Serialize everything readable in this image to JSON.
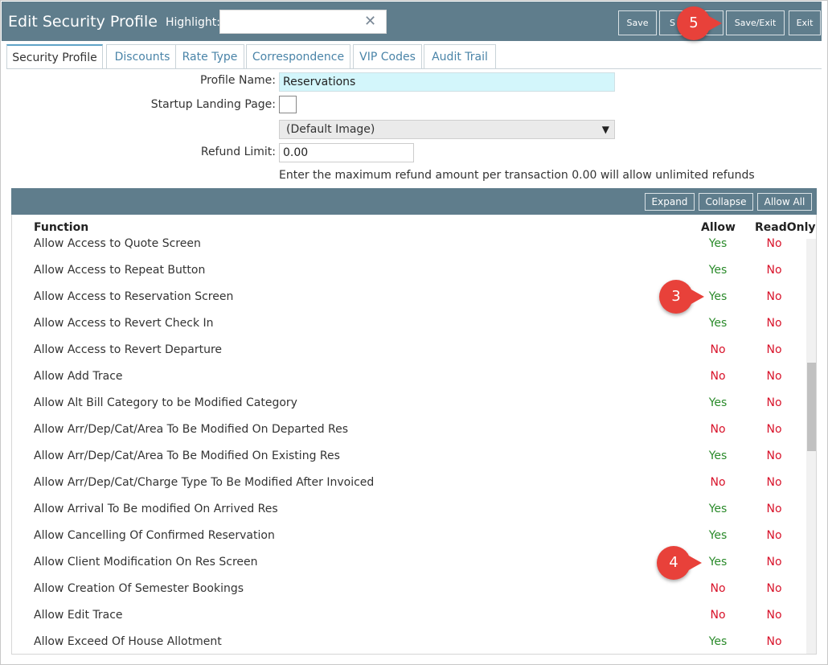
{
  "header": {
    "title": "Edit Security Profile",
    "highlight_label": "Highlight:",
    "highlight_value": "",
    "buttons": [
      {
        "label": "Save"
      },
      {
        "label": "S"
      },
      {
        "label": "Save/Exit"
      },
      {
        "label": "Exit"
      }
    ]
  },
  "annotations": [
    "5",
    "3",
    "4"
  ],
  "tabs": [
    "Security Profile",
    "Discounts",
    "Rate Type",
    "Correspondence",
    "VIP Codes",
    "Audit Trail"
  ],
  "form": {
    "profile_name_label": "Profile Name:",
    "profile_name_value": "Reservations",
    "startup_label": "Startup Landing Page:",
    "image_select_value": "(Default Image)",
    "refund_label": "Refund Limit:",
    "refund_value": "0.00",
    "refund_hint": "Enter the maximum refund amount per transaction 0.00 will allow unlimited refunds"
  },
  "grid": {
    "buttons": [
      "Expand",
      "Collapse",
      "Allow All"
    ],
    "columns": [
      "Function",
      "Allow",
      "ReadOnly"
    ],
    "rows": [
      {
        "fn": "Allow Access to Quote Screen",
        "allow": "Yes",
        "ro": "No"
      },
      {
        "fn": "Allow Access to Repeat Button",
        "allow": "Yes",
        "ro": "No"
      },
      {
        "fn": "Allow Access to Reservation Screen",
        "allow": "Yes",
        "ro": "No"
      },
      {
        "fn": "Allow Access to Revert Check In",
        "allow": "Yes",
        "ro": "No"
      },
      {
        "fn": "Allow Access to Revert Departure",
        "allow": "No",
        "ro": "No"
      },
      {
        "fn": "Allow Add Trace",
        "allow": "No",
        "ro": "No"
      },
      {
        "fn": "Allow Alt Bill Category to be Modified Category",
        "allow": "Yes",
        "ro": "No"
      },
      {
        "fn": "Allow Arr/Dep/Cat/Area To Be Modified On Departed Res",
        "allow": "No",
        "ro": "No"
      },
      {
        "fn": "Allow Arr/Dep/Cat/Area To Be Modified On Existing Res",
        "allow": "Yes",
        "ro": "No"
      },
      {
        "fn": "Allow Arr/Dep/Cat/Charge Type To Be Modified After Invoiced",
        "allow": "No",
        "ro": "No"
      },
      {
        "fn": "Allow Arrival To Be modified On Arrived Res",
        "allow": "Yes",
        "ro": "No"
      },
      {
        "fn": "Allow Cancelling Of Confirmed Reservation",
        "allow": "Yes",
        "ro": "No"
      },
      {
        "fn": "Allow Client Modification On Res Screen",
        "allow": "Yes",
        "ro": "No"
      },
      {
        "fn": "Allow Creation Of Semester Bookings",
        "allow": "No",
        "ro": "No"
      },
      {
        "fn": "Allow Edit Trace",
        "allow": "No",
        "ro": "No"
      },
      {
        "fn": "Allow Exceed Of House Allotment",
        "allow": "Yes",
        "ro": "No"
      }
    ]
  }
}
